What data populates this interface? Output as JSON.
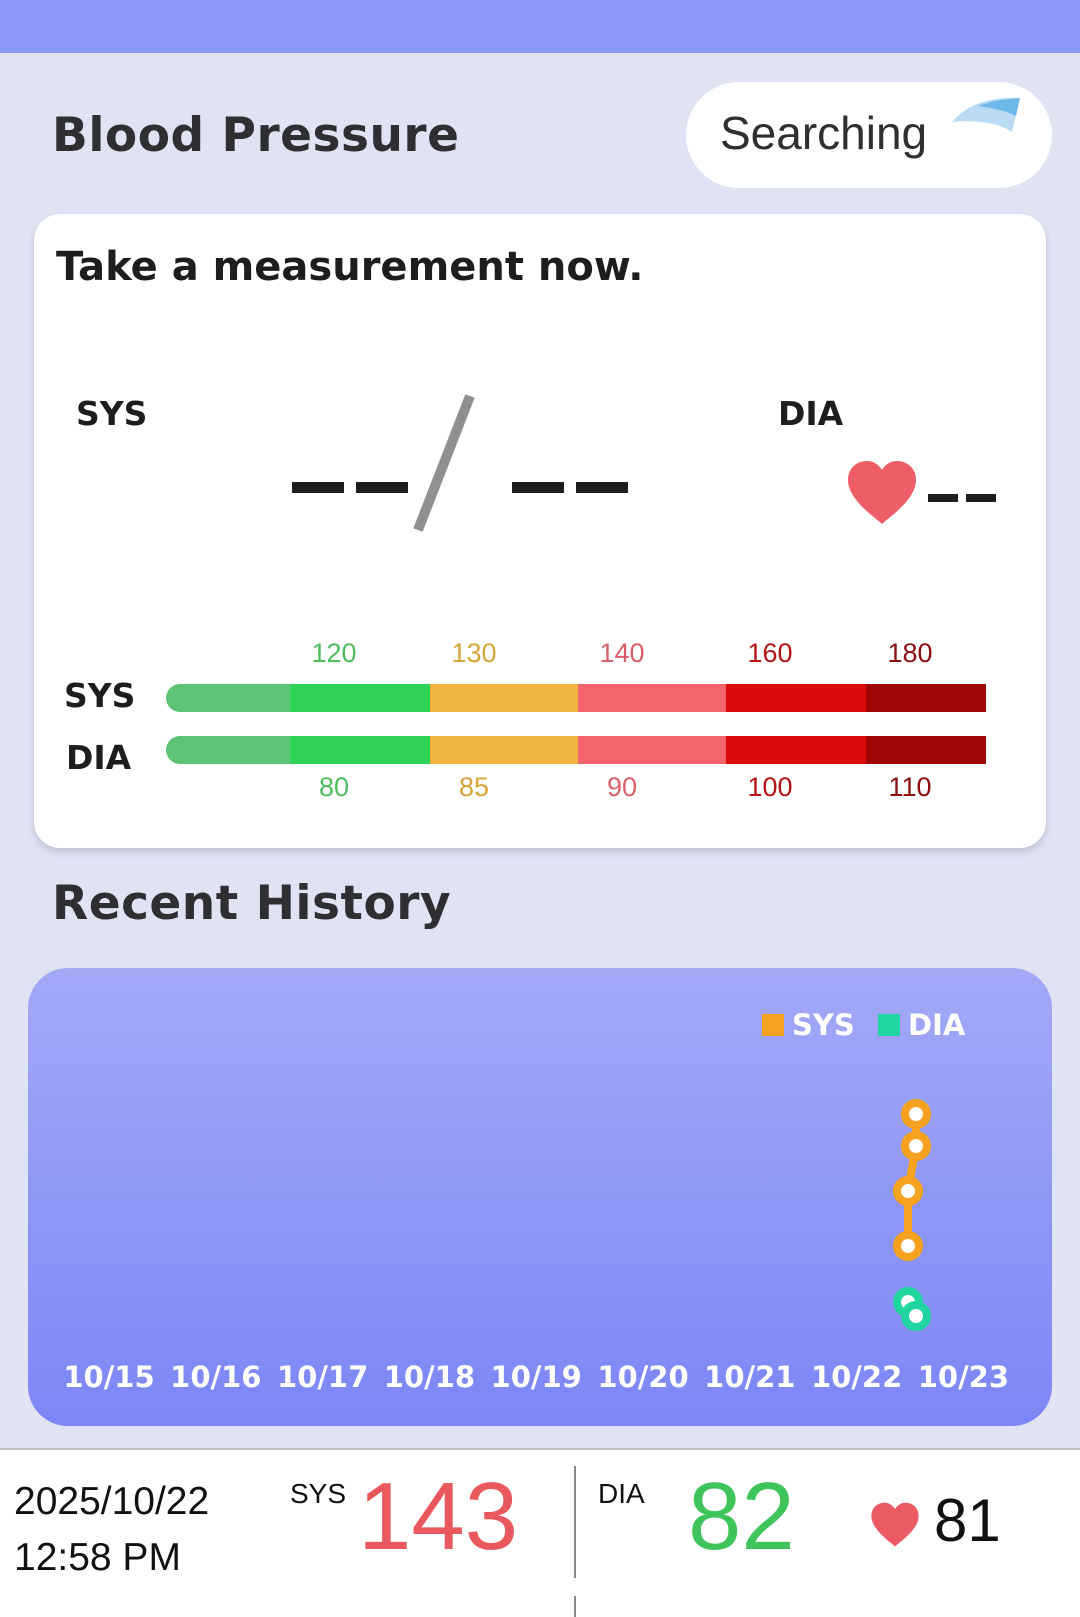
{
  "header": {
    "title": "Blood Pressure",
    "status": "Searching"
  },
  "measure": {
    "prompt": "Take a measurement now.",
    "sys_label": "SYS",
    "dia_label": "DIA",
    "heart_rate": "--"
  },
  "scale": {
    "sys_label": "SYS",
    "dia_label": "DIA",
    "sys_ticks": [
      "120",
      "130",
      "140",
      "160",
      "180"
    ],
    "dia_ticks": [
      "80",
      "85",
      "90",
      "100",
      "110"
    ],
    "tick_colors": [
      "#4fbd5c",
      "#d9a53a",
      "#d9606a",
      "#b51414",
      "#8c0f0f"
    ],
    "segment_colors": [
      "#5cc474",
      "#2fd356",
      "#f0b33d",
      "#f4646c",
      "#dc0a0a",
      "#a00808"
    ]
  },
  "history": {
    "title": "Recent History",
    "chart_data": {
      "type": "line",
      "legend_position": "top-right",
      "x": [
        "10/15",
        "10/16",
        "10/17",
        "10/18",
        "10/19",
        "10/20",
        "10/21",
        "10/22",
        "10/23"
      ],
      "series": [
        {
          "name": "SYS",
          "color": "#f7a21e"
        },
        {
          "name": "DIA",
          "color": "#20d6a0"
        }
      ]
    }
  },
  "latest": {
    "date": "2025/10/22",
    "time": "12:58 PM",
    "sys_label": "SYS",
    "sys_value": "143",
    "sys_color": "#e8585c",
    "dia_label": "DIA",
    "dia_value": "82",
    "dia_color": "#3ec45a",
    "heart_rate": "81",
    "heart_color": "#ec5a64"
  }
}
